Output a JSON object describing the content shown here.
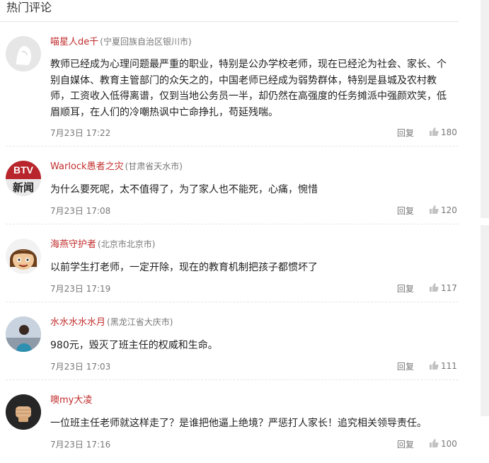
{
  "section": {
    "title": "热门评论"
  },
  "actions": {
    "reply_label": "回复"
  },
  "comments": [
    {
      "username": "喵星人de千",
      "location": "(宁夏回族自治区银川市)",
      "text": "教师已经成为心理问题最严重的职业，特别是公办学校老师，现在已经沦为社会、家长、个别自媒体、教育主管部门的众矢之的，中国老师已经成为弱势群体，特别是县城及农村教师，工资收入低得离谱，仅到当地公务员一半，却仍然在高强度的任务摊派中强颜欢笑，低眉顺耳，在人们的冷嘲热讽中亡命挣扎，苟延残喘。",
      "time": "7月23日 17:22",
      "likes": "180",
      "avatar": "default-user-avatar"
    },
    {
      "username": "Warlock愚者之灾",
      "location": "(甘肃省天水市)",
      "text": "为什么要死呢，太不值得了，为了家人也不能死，心痛，惋惜",
      "time": "7月23日 17:08",
      "likes": "120",
      "avatar": "btv-news-logo",
      "avatar_logo_top": "BTV",
      "avatar_logo_bottom": "新闻"
    },
    {
      "username": "海燕守护者",
      "location": "(北京市北京市)",
      "text": "以前学生打老师，一定开除，现在的教育机制把孩子都惯坏了",
      "time": "7月23日 17:19",
      "likes": "117",
      "avatar": "cartoon-face-avatar"
    },
    {
      "username": "水水水水水月",
      "location": "(黑龙江省大庆市)",
      "text": "980元，毁灭了班主任的权威和生命。",
      "time": "7月23日 17:03",
      "likes": "111",
      "avatar": "photo-avatar"
    },
    {
      "username": "噢my大凌",
      "location": "",
      "text": "一位班主任老师就这样走了？是谁把他逼上绝境？严惩打人家长！追究相关领导责任。",
      "time": "7月23日 17:16",
      "likes": "100",
      "avatar": "fist-avatar"
    }
  ],
  "colors": {
    "username": "#c12c2c",
    "meta": "#777777",
    "divider": "#e6e6e6",
    "avatar_default": "#e8e8e8"
  }
}
